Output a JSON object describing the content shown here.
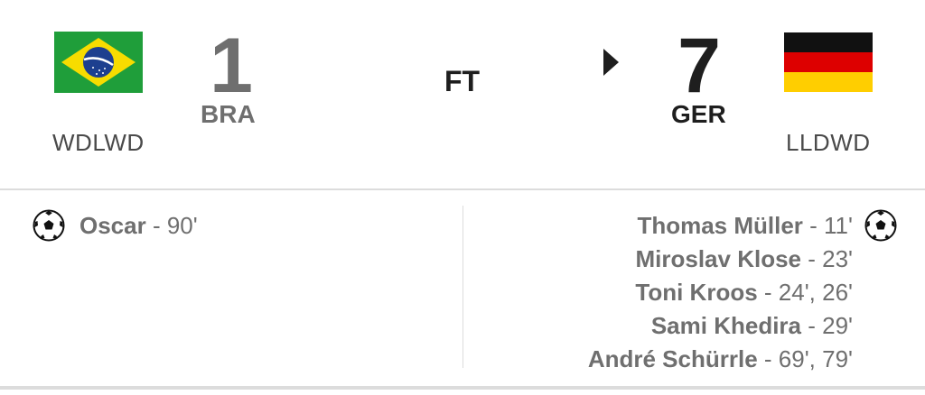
{
  "match": {
    "status": "FT",
    "home": {
      "abbr": "BRA",
      "score": "1",
      "form": "WDLWD",
      "flag_icon": "brazil-flag-icon",
      "colors": {
        "green": "#1f9e3a",
        "yellow": "#f7dc00",
        "blue": "#1d3f8f"
      },
      "scorers": [
        {
          "name": "Oscar",
          "sep": " - ",
          "minutes": "90'"
        }
      ]
    },
    "away": {
      "abbr": "GER",
      "score": "7",
      "form": "LLDWD",
      "flag_icon": "germany-flag-icon",
      "colors": {
        "black": "#111111",
        "red": "#dd0000",
        "gold": "#ffce00"
      },
      "scorers": [
        {
          "name": "Thomas Müller",
          "sep": " - ",
          "minutes": "11'"
        },
        {
          "name": "Miroslav Klose",
          "sep": " - ",
          "minutes": "23'"
        },
        {
          "name": "Toni Kroos",
          "sep": " - ",
          "minutes": "24', 26'"
        },
        {
          "name": "Sami Khedira",
          "sep": " - ",
          "minutes": "29'"
        },
        {
          "name": "André Schürrle",
          "sep": " - ",
          "minutes": "69', 79'"
        }
      ]
    },
    "winner_indicator_icon": "winner-arrow-icon",
    "goal_icon": "soccer-ball-icon"
  }
}
